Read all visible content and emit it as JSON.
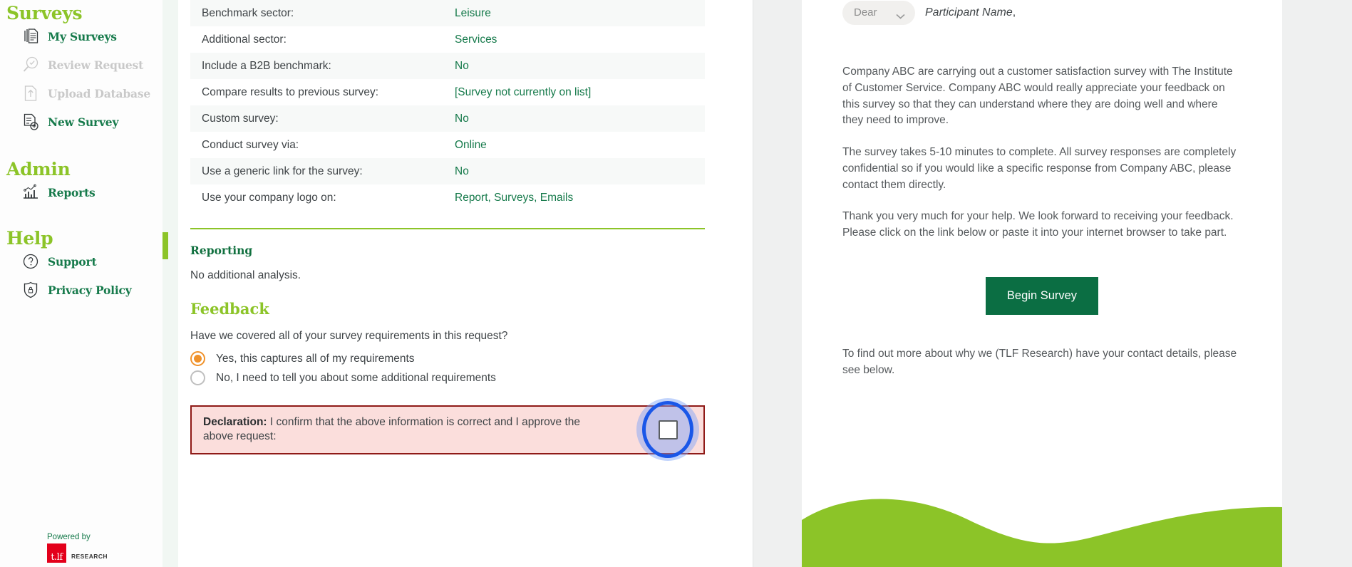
{
  "sidebar": {
    "groups": [
      {
        "title": "Surveys",
        "items": [
          {
            "label": "My Surveys",
            "icon": "documents-stack-icon",
            "disabled": false
          },
          {
            "label": "Review Request",
            "icon": "magnifier-check-icon",
            "disabled": true
          },
          {
            "label": "Upload Database",
            "icon": "upload-document-icon",
            "disabled": true
          },
          {
            "label": "New Survey",
            "icon": "new-document-plus-icon",
            "disabled": false
          }
        ]
      },
      {
        "title": "Admin",
        "items": [
          {
            "label": "Reports",
            "icon": "bar-chart-icon",
            "disabled": false
          }
        ]
      },
      {
        "title": "Help",
        "items": [
          {
            "label": "Support",
            "icon": "question-circle-icon",
            "disabled": false
          },
          {
            "label": "Privacy Policy",
            "icon": "shield-lock-icon",
            "disabled": false
          }
        ]
      }
    ],
    "footer": {
      "powered_by": "Powered by",
      "logo_mark": "t.lf",
      "logo_word": "RESEARCH"
    }
  },
  "main": {
    "detail_rows": [
      {
        "key": "Benchmark sector:",
        "value": "Leisure"
      },
      {
        "key": "Additional sector:",
        "value": "Services"
      },
      {
        "key": "Include a B2B benchmark:",
        "value": "No"
      },
      {
        "key": "Compare results to previous survey:",
        "value": "[Survey not currently on list]"
      },
      {
        "key": "Custom survey:",
        "value": "No"
      },
      {
        "key": "Conduct survey via:",
        "value": "Online"
      },
      {
        "key": "Use a generic link for the survey:",
        "value": "No"
      },
      {
        "key": "Use your company logo on:",
        "value": "Report, Surveys, Emails"
      }
    ],
    "reporting": {
      "heading": "Reporting",
      "text": "No additional analysis."
    },
    "feedback": {
      "heading": "Feedback",
      "question": "Have we covered all of your survey requirements in this request?",
      "options": [
        {
          "label": "Yes, this captures all of my requirements",
          "selected": true
        },
        {
          "label": "No, I need to tell you about some additional requirements",
          "selected": false
        }
      ]
    },
    "declaration": {
      "label": "Declaration:",
      "text": " I confirm that the above information is correct and I approve the above request:",
      "checked": false
    }
  },
  "email_preview": {
    "salutation": "Dear",
    "participant_placeholder": "Participant Name",
    "participant_suffix": ",",
    "paragraphs": [
      "Company ABC are carrying out a customer satisfaction survey with The Institute of Customer Service. Company ABC would really appreciate your feedback on this survey so that they can understand where they are doing well and where they need to improve.",
      "The survey takes 5-10 minutes to complete. All survey responses are completely confidential so if you would like a specific response from Company ABC, please contact them directly.",
      "Thank you very much for your help. We look forward to receiving your feedback. Please click on the link below or paste it into your internet browser to take part."
    ],
    "cta_label": "Begin Survey",
    "footer_note": "To find out more about why we (TLF Research) have your contact details, please see below."
  },
  "colors": {
    "brand_green": "#8cc428",
    "dark_green": "#167a4b",
    "cta_green": "#0b6e43",
    "radio_orange": "#f0922b",
    "declaration_border": "#8f1a17",
    "declaration_bg": "#fbdedc",
    "highlight_ring": "#1a57e8"
  }
}
